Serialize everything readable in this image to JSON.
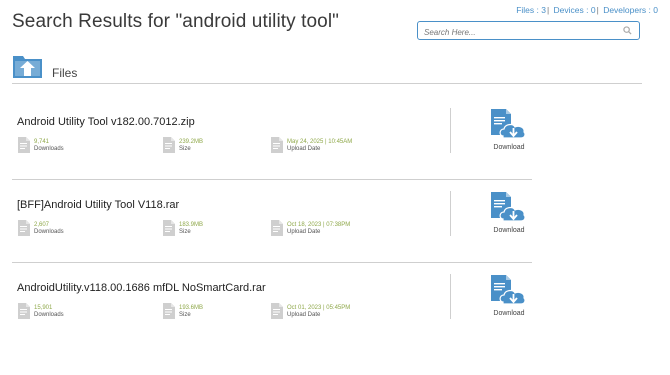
{
  "header": {
    "title": "Search Results for \"android utility tool\"",
    "counts": [
      {
        "label": "Files : 3"
      },
      {
        "label": "Devices : 0"
      },
      {
        "label": "Developers : 0"
      }
    ],
    "search": {
      "placeholder": "Search Here..."
    }
  },
  "section": {
    "title": "Files"
  },
  "files": [
    {
      "name": "Android Utility Tool v182.00.7012.zip",
      "downloads": "9,741",
      "downloads_label": "Downloads",
      "size": "239.2MB",
      "size_label": "Size",
      "upload_date": "May 24, 2025 | 10:45AM",
      "upload_date_label": "Upload Date",
      "download_label": "Download"
    },
    {
      "name": "[BFF]Android Utility Tool V118.rar",
      "downloads": "2,607",
      "downloads_label": "Downloads",
      "size": "183.9MB",
      "size_label": "Size",
      "upload_date": "Oct 18, 2023 | 07:38PM",
      "upload_date_label": "Upload Date",
      "download_label": "Download"
    },
    {
      "name": "AndroidUtility.v118.00.1686 mfDL NoSmartCard.rar",
      "downloads": "15,901",
      "downloads_label": "Downloads",
      "size": "193.6MB",
      "size_label": "Size",
      "upload_date": "Oct 01, 2023 | 05:45PM",
      "upload_date_label": "Upload Date",
      "download_label": "Download"
    }
  ],
  "colors": {
    "accent": "#4a90c8",
    "meta_value": "#8fa84a",
    "icon_gray": "#bdbdbd"
  }
}
